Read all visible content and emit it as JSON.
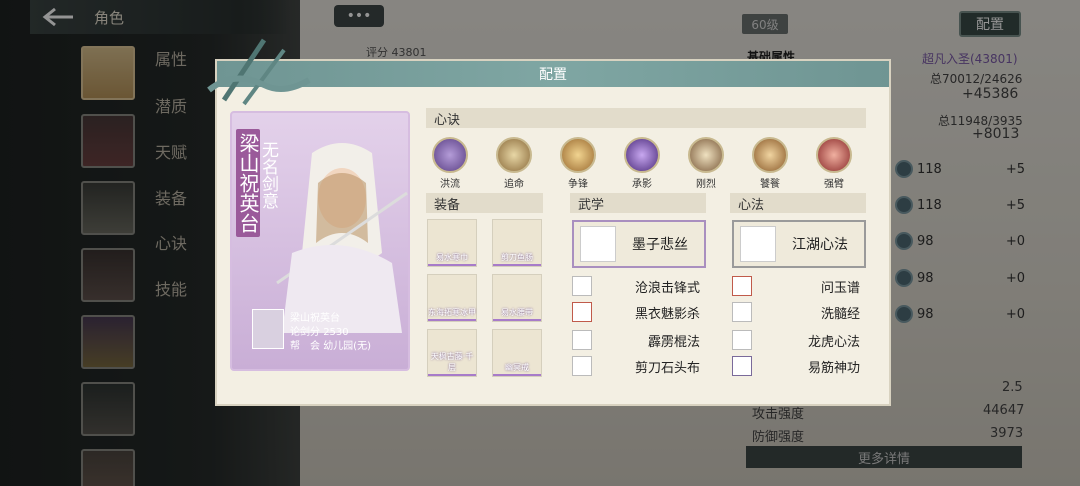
{
  "header": {
    "title": "角色"
  },
  "nav": {
    "items": [
      "属性",
      "潜质",
      "天赋",
      "装备",
      "心诀",
      "技能"
    ]
  },
  "right": {
    "score_label": "评分",
    "score": "43801",
    "level": "60级",
    "config_btn": "配置",
    "base_attr": "基础属性",
    "rank": "超凡入圣(43801)",
    "total1": "总70012/24626",
    "plus1": "+45386",
    "total2": "总11948/3935",
    "plus2": "+8013",
    "stats": [
      {
        "num": "118",
        "plus": "+5"
      },
      {
        "num": "118",
        "plus": "+5"
      },
      {
        "num": "98",
        "plus": "+0"
      },
      {
        "num": "98",
        "plus": "+0"
      },
      {
        "num": "98",
        "plus": "+0"
      }
    ],
    "v_extra": "2.5",
    "atk_label": "攻击强度",
    "atk": "44647",
    "def_label": "防御强度",
    "def": "3973",
    "more": "更多详情"
  },
  "modal": {
    "title": "配置",
    "card": {
      "name": "梁山祝英台",
      "sub": "无名剑意",
      "nick": "梁山祝英台",
      "score_label": "论剑分",
      "score": "2530",
      "guild_label": "帮　会",
      "guild": "幼儿园(无)"
    },
    "xinjue_title": "心诀",
    "xinjue": [
      "洪流",
      "追命",
      "争锋",
      "承影",
      "刚烈",
      "饕餮",
      "强臂"
    ],
    "equip_title": "装备",
    "equips": [
      "易水寒巾",
      "剪刀鱼肠",
      "东海拓寒冰甲",
      "易水腰带",
      "天枫古藤·千层",
      "幽冥戒"
    ],
    "wuxue_title": "武学",
    "wuxue_main": "墨子悲丝",
    "wuxue": [
      "沧浪击锋式",
      "黑衣魅影杀",
      "霹雳棍法",
      "剪刀石头布"
    ],
    "xinfa_title": "心法",
    "xinfa_main": "江湖心法",
    "xinfa": [
      "问玉谱",
      "洗髓经",
      "龙虎心法",
      "易筋神功"
    ]
  },
  "colors": {
    "accent": "#7fa6a3",
    "purple": "#a77bc9",
    "panel": "#f3efe3"
  }
}
